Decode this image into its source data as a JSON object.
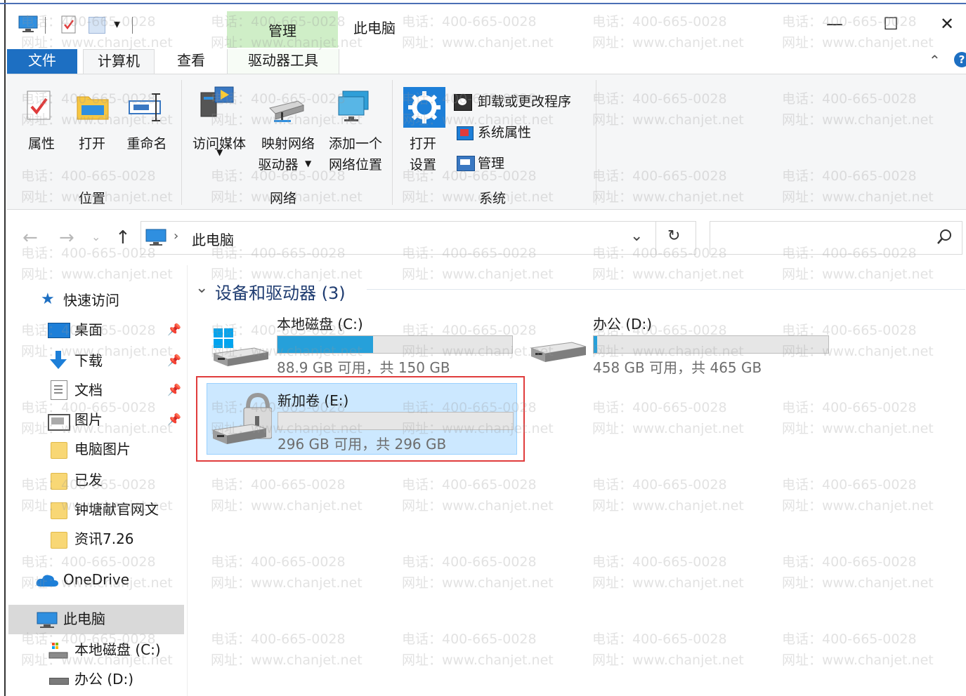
{
  "window": {
    "title": "此电脑",
    "context_tab_header": "管理",
    "caption_minimize": "—",
    "caption_maximize": "☐",
    "caption_close": "✕"
  },
  "ribbon_tabs": [
    "文件",
    "计算机",
    "查看",
    "驱动器工具"
  ],
  "ribbon": {
    "location": {
      "group_label": "位置",
      "properties": "属性",
      "open": "打开",
      "rename": "重命名"
    },
    "network": {
      "group_label": "网络",
      "access_media": "访问媒体",
      "map_drive_line1": "映射网络",
      "map_drive_line2": "驱动器",
      "add_location_line1": "添加一个",
      "add_location_line2": "网络位置"
    },
    "system": {
      "group_label": "系统",
      "open_settings_line1": "打开",
      "open_settings_line2": "设置",
      "uninstall": "卸载或更改程序",
      "system_properties": "系统属性",
      "manage": "管理"
    },
    "collapse_icon": "chevron-up-icon",
    "help_label": "?"
  },
  "address_bar": {
    "path": "此电脑",
    "search_placeholder": ""
  },
  "nav": {
    "quick_access": "快速访问",
    "items": [
      {
        "label": "桌面",
        "icon": "desktop-icon",
        "pinned": true
      },
      {
        "label": "下载",
        "icon": "download-icon",
        "pinned": true
      },
      {
        "label": "文档",
        "icon": "document-icon",
        "pinned": true
      },
      {
        "label": "图片",
        "icon": "pictures-icon",
        "pinned": true
      },
      {
        "label": "电脑图片",
        "icon": "folder-icon",
        "pinned": false
      },
      {
        "label": "已发",
        "icon": "folder-icon",
        "pinned": false
      },
      {
        "label": "钟塘献官网文",
        "icon": "folder-icon",
        "pinned": false
      },
      {
        "label": "资讯7.26",
        "icon": "folder-icon",
        "pinned": false
      }
    ],
    "onedrive": "OneDrive",
    "this_pc": "此电脑",
    "drive_c": "本地磁盘 (C:)",
    "drive_d": "办公 (D:)"
  },
  "content": {
    "section_header": "设备和驱动器 (3)",
    "drives": [
      {
        "name": "本地磁盘 (C:)",
        "space": "88.9 GB 可用，共 150 GB",
        "used_fraction": 0.407
      },
      {
        "name": "办公 (D:)",
        "space": "458 GB 可用，共 465 GB",
        "used_fraction": 0.015
      },
      {
        "name": "新加卷 (E:)",
        "space": "296 GB 可用，共 296 GB",
        "used_fraction": 0.0,
        "selected": true
      }
    ]
  },
  "watermark": {
    "phone": "电话：400-665-0028",
    "site": "网址：www.chanjet.net"
  },
  "colors": {
    "accent": "#1d6fc2",
    "usage_bar": "#26a0da",
    "selection": "#cce8ff",
    "highlight_box": "#e03c3c",
    "manage_tab": "#cfeec7"
  }
}
